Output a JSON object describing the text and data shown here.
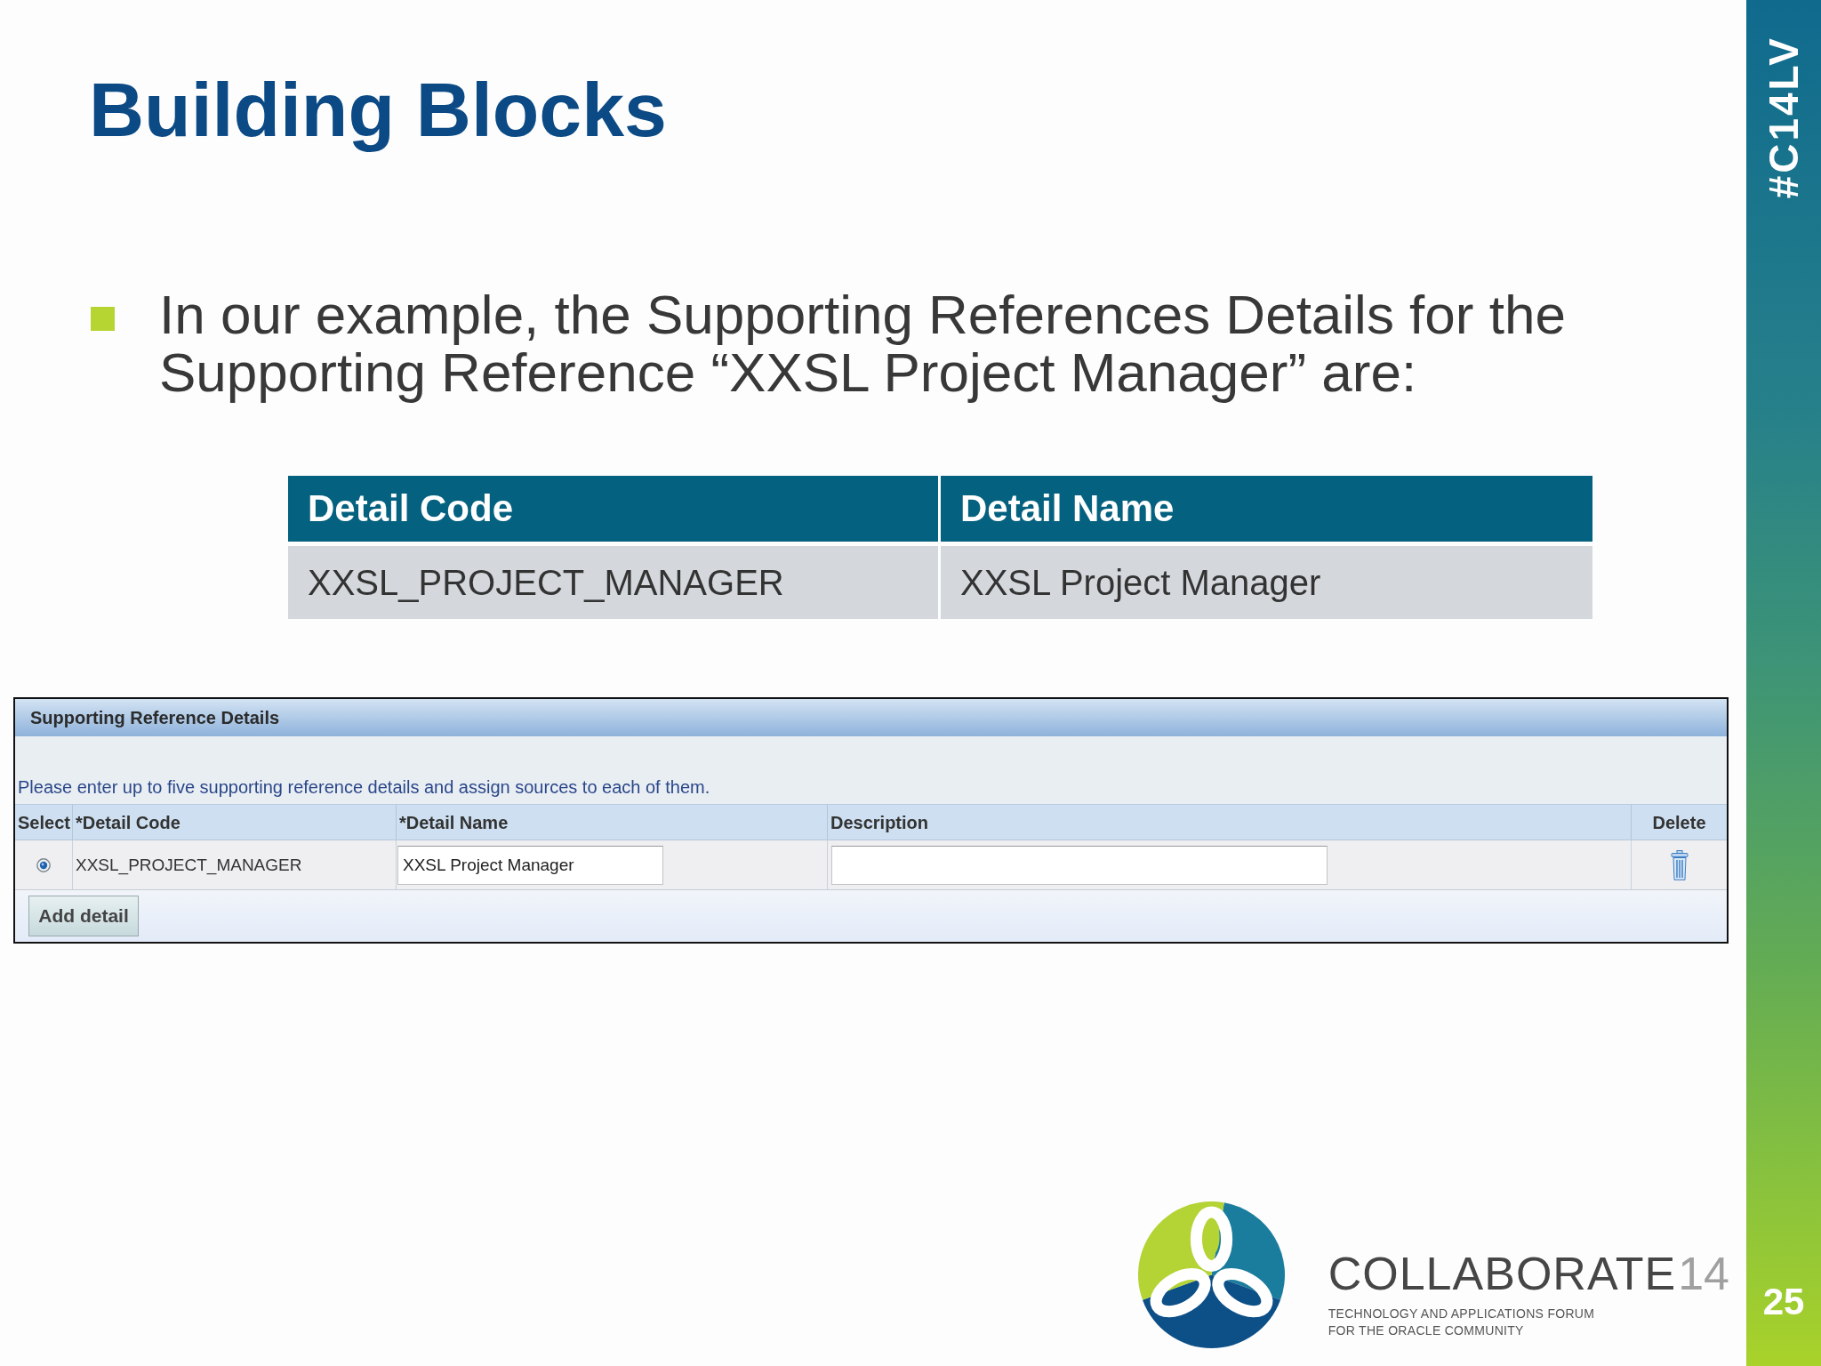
{
  "slide": {
    "title": "Building Blocks",
    "bullets": [
      "In our example, the Supporting References Details for the Supporting Reference “XXSL Project Manager” are:"
    ]
  },
  "summary_table": {
    "columns": [
      "Detail Code",
      "Detail Name"
    ],
    "rows": [
      [
        "XXSL_PROJECT_MANAGER",
        "XXSL Project Manager"
      ]
    ]
  },
  "form_panel": {
    "title": "Supporting Reference Details",
    "instructions": "Please enter up to five supporting reference details and assign sources to each of them.",
    "columns": [
      "Select",
      "*Detail Code",
      "*Detail Name",
      "Description",
      "Delete"
    ],
    "rows": [
      {
        "selected": true,
        "detail_code": "XXSL_PROJECT_MANAGER",
        "detail_name": "XXSL Project Manager"
      }
    ],
    "add_button": "Add detail"
  },
  "logo": {
    "name": "COLLABORATE",
    "edition": "14",
    "tagline": [
      "TECHNOLOGY AND APPLICATIONS FORUM",
      "FOR THE ORACLE COMMUNITY"
    ]
  },
  "side_bar": {
    "hashtag": "#C14LV",
    "page_number": "25"
  }
}
